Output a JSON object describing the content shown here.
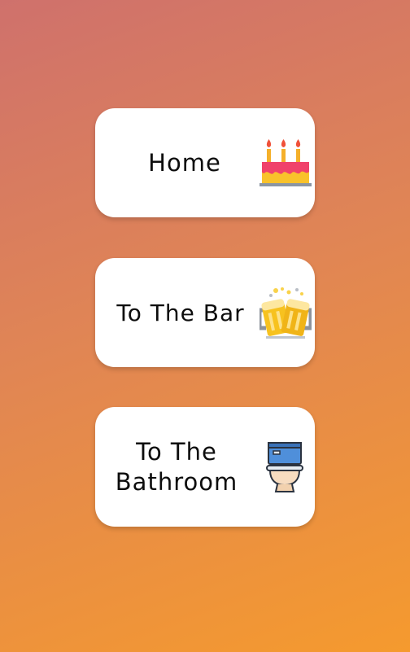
{
  "cards": [
    {
      "id": "home",
      "label": "Home",
      "icon": "birthday-cake-icon"
    },
    {
      "id": "bar",
      "label": "To The Bar",
      "icon": "beer-mugs-icon"
    },
    {
      "id": "bathroom",
      "label_line1": "To The",
      "label_line2": "Bathroom",
      "icon": "toilet-icon"
    }
  ],
  "colors": {
    "background_top": "#cf716c",
    "background_bottom": "#f59a2e",
    "card": "#ffffff",
    "text": "#0d0d0d"
  }
}
